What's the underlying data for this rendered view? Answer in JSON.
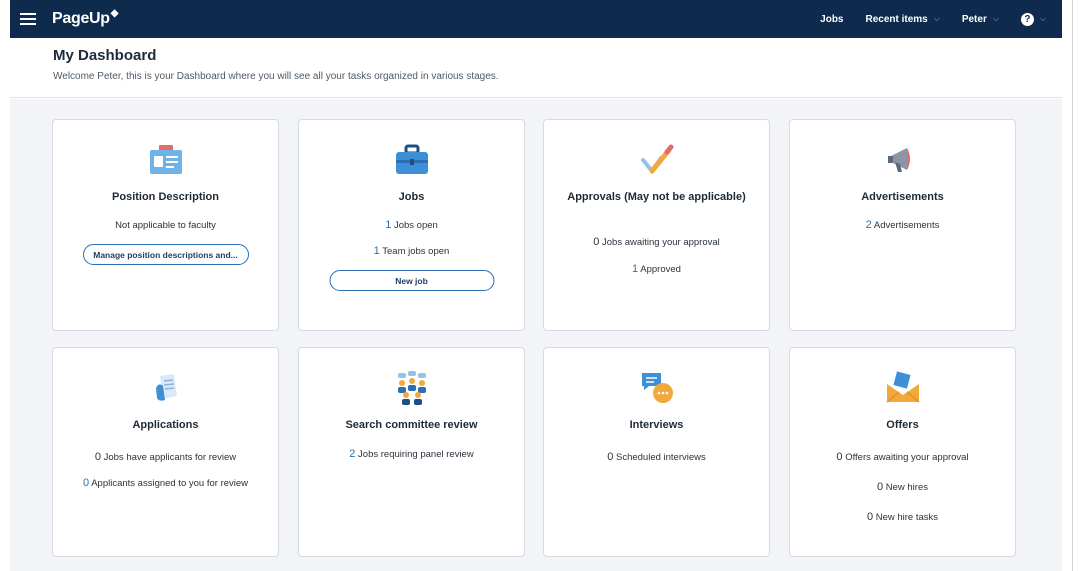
{
  "topbar": {
    "brand": "PageUp",
    "nav": [
      {
        "label": "Jobs"
      },
      {
        "label": "Recent items"
      },
      {
        "label": "Peter"
      }
    ],
    "help_glyph": "?"
  },
  "header": {
    "title": "My Dashboard",
    "welcome": "Welcome Peter, this is your Dashboard where you will see all your tasks organized in various stages."
  },
  "colors": {
    "topbar": "#0e2a4d",
    "accent": "#2c6fb2",
    "background": "#f2f4f8"
  },
  "cards": {
    "position_description": {
      "icon": "id-card-icon",
      "title": "Position Description",
      "text": "Not applicable to faculty",
      "button": "Manage position descriptions and..."
    },
    "jobs": {
      "icon": "briefcase-icon",
      "title": "Jobs",
      "jobs_open_count": "1",
      "jobs_open_label": "Jobs open",
      "team_jobs_count": "1",
      "team_jobs_label": "Team jobs open",
      "button": "New job"
    },
    "approvals": {
      "icon": "checkmark-pencil-icon",
      "title": "Approvals (May not be applicable)",
      "awaiting_count": "0",
      "awaiting_label": "Jobs awaiting your approval",
      "approved_count": "1",
      "approved_label": "Approved"
    },
    "advertisements": {
      "icon": "megaphone-icon",
      "title": "Advertisements",
      "count": "2",
      "label": "Advertisements"
    },
    "applications": {
      "icon": "documents-icon",
      "title": "Applications",
      "review_count": "0",
      "review_label": "Jobs have applicants for review",
      "assigned_count": "0",
      "assigned_label": "Applicants assigned to you for review"
    },
    "search_committee": {
      "icon": "committee-icon",
      "title": "Search committee review",
      "count": "2",
      "label": "Jobs requiring panel review"
    },
    "interviews": {
      "icon": "chat-bubbles-icon",
      "title": "Interviews",
      "count": "0",
      "label": "Scheduled interviews"
    },
    "offers": {
      "icon": "envelope-icon",
      "title": "Offers",
      "awaiting_count": "0",
      "awaiting_label": "Offers awaiting your approval",
      "new_hires_count": "0",
      "new_hires_label": "New hires",
      "tasks_count": "0",
      "tasks_label": "New hire tasks"
    }
  }
}
